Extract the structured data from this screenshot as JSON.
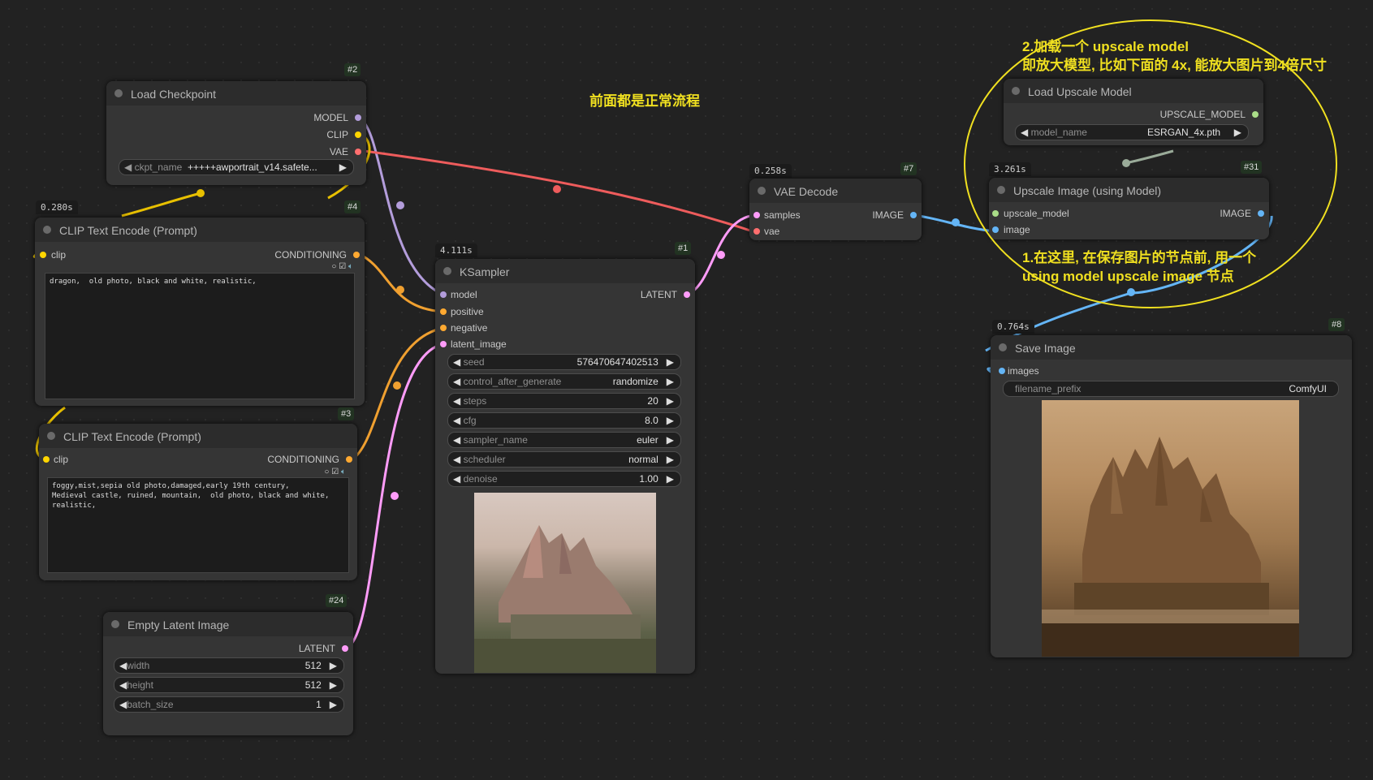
{
  "colors": {
    "canvas": "#222222",
    "node_bg": "#353535",
    "model": "#b39ddb",
    "clip": "#ffd500",
    "vae": "#ff6e6e",
    "conditioning": "#ffa931",
    "latent": "#ff9cf9",
    "image": "#64b5f6",
    "upscale_model": "#aadd88",
    "annotation": "#f0e020"
  },
  "nodes": {
    "load_checkpoint": {
      "id": "#2",
      "title": "Load Checkpoint",
      "outputs": [
        "MODEL",
        "CLIP",
        "VAE"
      ],
      "widget": {
        "label": "ckpt_name",
        "value": "+++++awportrait_v14.safete..."
      }
    },
    "clip_pos": {
      "id": "#4",
      "time": "0.280s",
      "title": "CLIP Text Encode (Prompt)",
      "input": "clip",
      "output": "CONDITIONING",
      "text": "dragon,  old photo, black and white, realistic,"
    },
    "clip_neg": {
      "id": "#3",
      "title": "CLIP Text Encode (Prompt)",
      "input": "clip",
      "output": "CONDITIONING",
      "text": "foggy,mist,sepia old photo,damaged,early 19th century,\nMedieval castle, ruined, mountain,  old photo, black and white,\nrealistic,"
    },
    "empty_latent": {
      "id": "#24",
      "title": "Empty Latent Image",
      "output": "LATENT",
      "widgets": [
        {
          "label": "width",
          "value": "512"
        },
        {
          "label": "height",
          "value": "512"
        },
        {
          "label": "batch_size",
          "value": "1"
        }
      ]
    },
    "ksampler": {
      "id": "#1",
      "time": "4.111s",
      "title": "KSampler",
      "inputs": [
        "model",
        "positive",
        "negative",
        "latent_image"
      ],
      "output": "LATENT",
      "widgets": [
        {
          "label": "seed",
          "value": "576470647402513"
        },
        {
          "label": "control_after_generate",
          "value": "randomize"
        },
        {
          "label": "steps",
          "value": "20"
        },
        {
          "label": "cfg",
          "value": "8.0"
        },
        {
          "label": "sampler_name",
          "value": "euler"
        },
        {
          "label": "scheduler",
          "value": "normal"
        },
        {
          "label": "denoise",
          "value": "1.00"
        }
      ]
    },
    "vae_decode": {
      "id": "#7",
      "time": "0.258s",
      "title": "VAE Decode",
      "inputs": [
        "samples",
        "vae"
      ],
      "output": "IMAGE"
    },
    "load_upscale": {
      "title": "Load Upscale Model",
      "output": "UPSCALE_MODEL",
      "widget": {
        "label": "model_name",
        "value": "ESRGAN_4x.pth"
      }
    },
    "upscale_image": {
      "id": "#31",
      "time": "3.261s",
      "title": "Upscale Image (using Model)",
      "inputs": [
        "upscale_model",
        "image"
      ],
      "output": "IMAGE"
    },
    "save_image": {
      "id": "#8",
      "time": "0.764s",
      "title": "Save Image",
      "input": "images",
      "widget": {
        "label": "filename_prefix",
        "value": "ComfyUI"
      }
    }
  },
  "annotations": {
    "middle": "前面都是正常流程",
    "top_line1": "2.加载一个 upscale model",
    "top_line2": "即放大模型, 比如下面的 4x, 能放大图片到4倍尺寸",
    "bottom_line1": "1.在这里, 在保存图片的节点前, 用一个",
    "bottom_line2": "using model upscale image 节点"
  }
}
